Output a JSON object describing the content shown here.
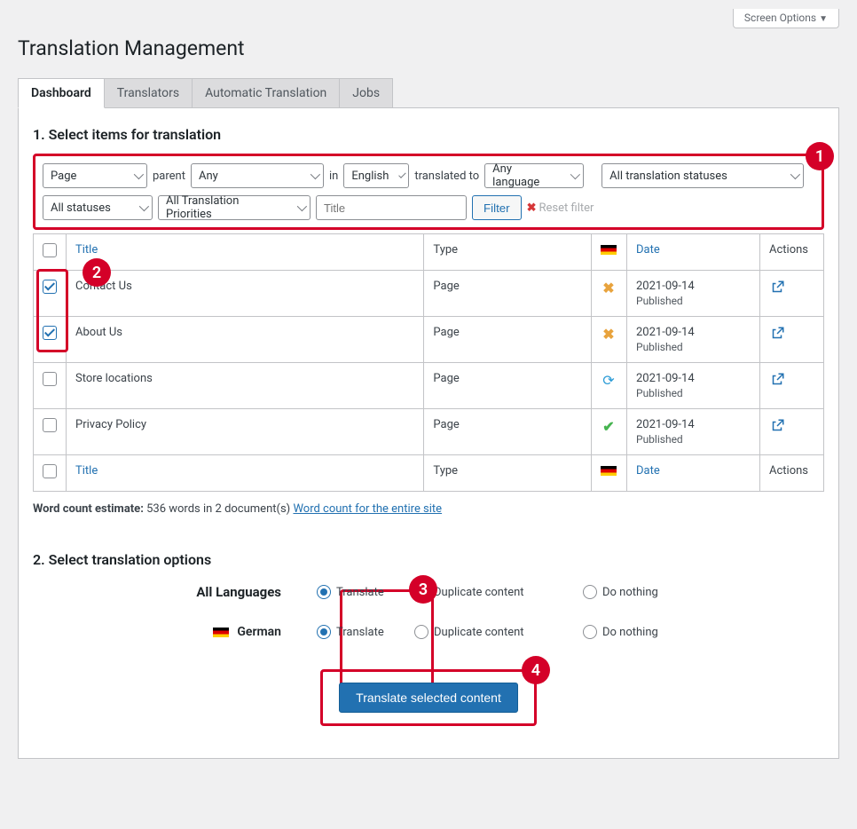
{
  "screen_options_label": "Screen Options",
  "page_title": "Translation Management",
  "tabs": [
    "Dashboard",
    "Translators",
    "Automatic Translation",
    "Jobs"
  ],
  "section1": {
    "heading": "1. Select items for translation",
    "filters": {
      "post_type": "Page",
      "parent_label": "parent",
      "parent_value": "Any",
      "in_label": "in",
      "source_lang": "English",
      "translated_to_label": "translated to",
      "target_lang": "Any language",
      "translation_status": "All translation statuses",
      "status": "All statuses",
      "priority": "All Translation Priorities",
      "title_placeholder": "Title",
      "filter_btn": "Filter",
      "reset_label": "Reset filter"
    },
    "columns": {
      "title": "Title",
      "type": "Type",
      "date": "Date",
      "actions": "Actions"
    },
    "rows": [
      {
        "title": "Contact Us",
        "type": "Page",
        "status": "x",
        "date": "2021-09-14",
        "state": "Published",
        "checked": true
      },
      {
        "title": "About Us",
        "type": "Page",
        "status": "x",
        "date": "2021-09-14",
        "state": "Published",
        "checked": true
      },
      {
        "title": "Store locations",
        "type": "Page",
        "status": "refresh",
        "date": "2021-09-14",
        "state": "Published",
        "checked": false
      },
      {
        "title": "Privacy Policy",
        "type": "Page",
        "status": "check",
        "date": "2021-09-14",
        "state": "Published",
        "checked": false
      }
    ],
    "wordcount": {
      "prefix": "Word count estimate:",
      "text": "536 words in 2 document(s)",
      "link": "Word count for the entire site"
    }
  },
  "section2": {
    "heading": "2. Select translation options",
    "all_languages_label": "All Languages",
    "german_label": "German",
    "opt_translate": "Translate",
    "opt_duplicate": "Duplicate content",
    "opt_nothing": "Do nothing",
    "submit_label": "Translate selected content"
  },
  "badges": {
    "b1": "1",
    "b2": "2",
    "b3": "3",
    "b4": "4"
  }
}
